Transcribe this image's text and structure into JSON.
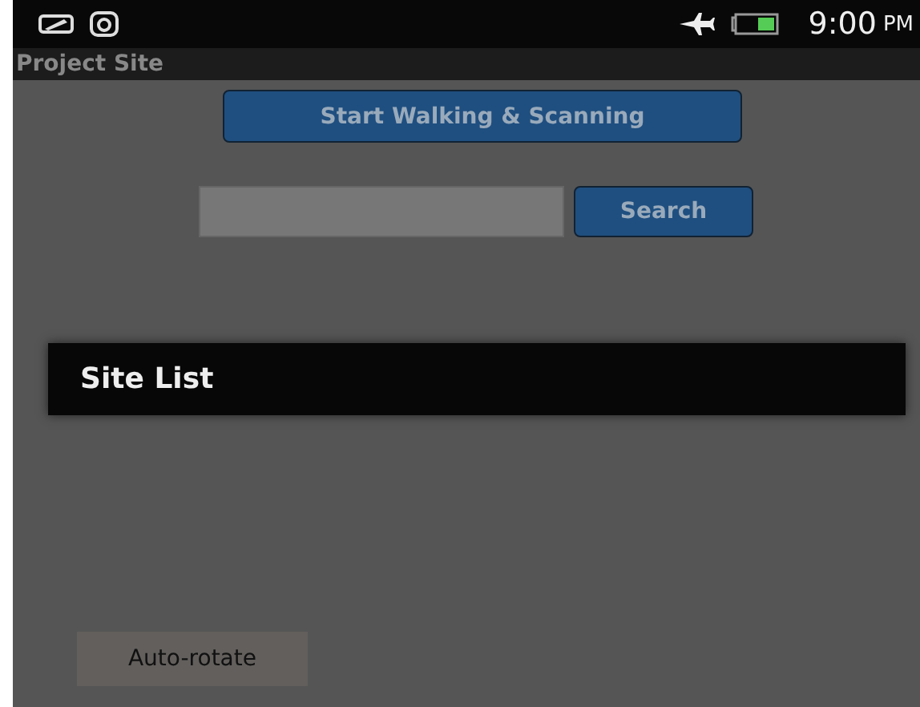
{
  "status_bar": {
    "time": "9:00",
    "ampm": "PM"
  },
  "title_bar": {
    "title": "Project Site"
  },
  "start_button": {
    "label": "Start Walking & Scanning"
  },
  "search": {
    "button": "Search"
  },
  "site_list": {
    "title": "Site List"
  },
  "toast": {
    "text": "Auto-rotate"
  }
}
